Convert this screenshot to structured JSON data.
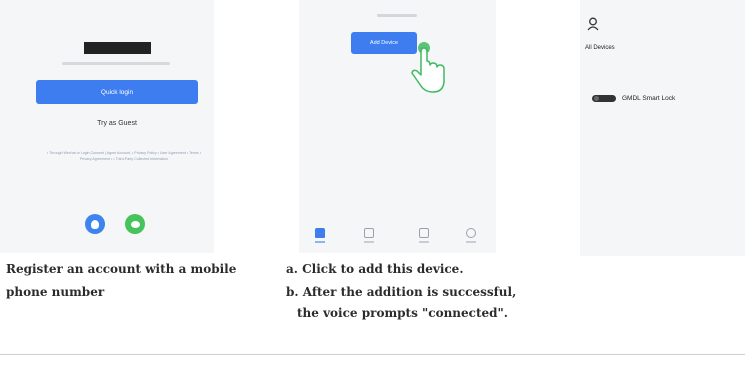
{
  "login_screen": {
    "quick_login_label": "Quick login",
    "guest_label": "Try as Guest",
    "agreement_text": "• Through Wechat or Login Consent | Agree Account, • Privacy Policy • User Agreement • Terms • Privacy Agreement • • Third-Party Collected Information"
  },
  "home_screen": {
    "add_device_label": "Add Device"
  },
  "devices_screen": {
    "section_title": "All Devices",
    "device_name": "GMDL Smart Lock"
  },
  "captions": {
    "step1": "Register an account with a mobile phone number",
    "step2a": "a. Click to add this device.",
    "step2b": "b. After the addition is successful,",
    "step2c": "the voice prompts \"connected\"."
  },
  "colors": {
    "accent": "#3e7df0",
    "hand_outline": "#3dbb61"
  }
}
